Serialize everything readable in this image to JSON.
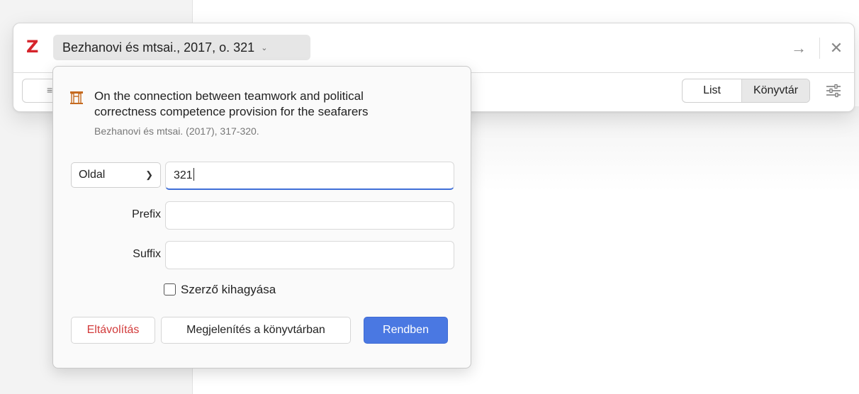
{
  "quick_format": {
    "logo": "Z",
    "citation_label": "Bezhanovi és mtsai., 2017, o. 321",
    "citation_chevron": "⌄",
    "next_arrow": "→",
    "close": "✕",
    "left_stub_glyph": "≡",
    "mode_buttons": {
      "list": "List",
      "library": "Könyvtár"
    },
    "settings_icon": "settings-sliders"
  },
  "popup": {
    "item_icon": "book-chapter-icon",
    "item_title": "On the connection between teamwork and political correctness competence provision for the seafarers",
    "item_meta": "Bezhanovi és mtsai. (2017), 317-320.",
    "locator_type": "Oldal",
    "locator_value": "321",
    "prefix_label": "Prefix",
    "prefix_value": "",
    "suffix_label": "Suffix",
    "suffix_value": "",
    "suppress_author_label": "Szerző kihagyása",
    "suppress_author_checked": false,
    "buttons": {
      "remove": "Eltávolítás",
      "show_in_library": "Megjelenítés a könyvtárban",
      "ok": "Rendben"
    }
  },
  "colors": {
    "zotero_red": "#d6242b",
    "accent_blue": "#4a78e2",
    "remove_red": "#d23b3b"
  }
}
